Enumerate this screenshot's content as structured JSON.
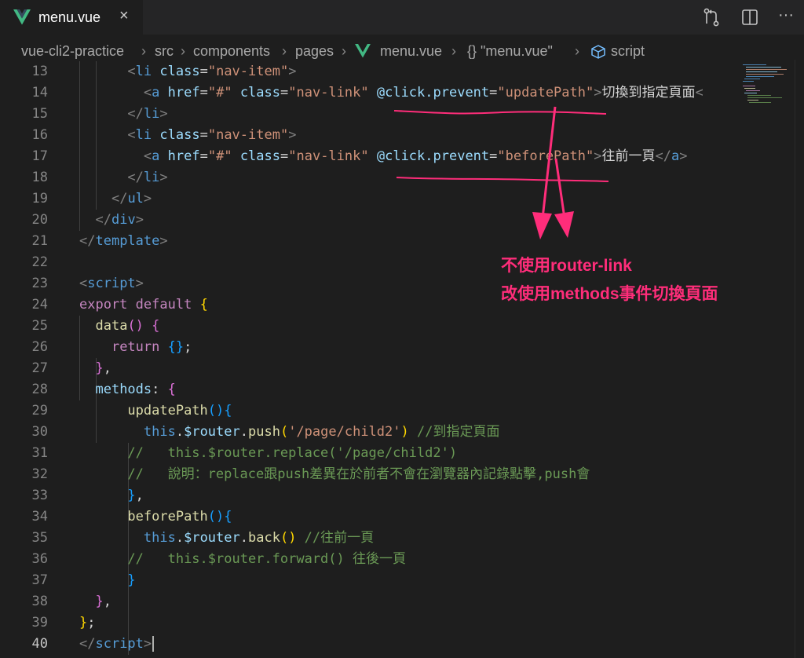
{
  "tab": {
    "title": "menu.vue",
    "close": "×"
  },
  "toolbar": {
    "more": "···"
  },
  "breadcrumbs": [
    "vue-cli2-practice",
    "src",
    "components",
    "pages",
    "menu.vue",
    "{} \"menu.vue\"",
    "script"
  ],
  "annotation": {
    "line1": "不使用router-link",
    "line2": "改使用methods事件切換頁面"
  },
  "colors": {
    "accent": "#ff2d7a",
    "vue_green": "#42b883",
    "background": "#1e1e1e"
  },
  "code_lines": [
    {
      "n": "13",
      "tokens": [
        {
          "t": "      ",
          "c": "#d4d4d4"
        },
        {
          "t": "<",
          "c": "#808080"
        },
        {
          "t": "li",
          "c": "#569cd6"
        },
        {
          "t": " ",
          "c": "#d4d4d4"
        },
        {
          "t": "class",
          "c": "#9cdcfe"
        },
        {
          "t": "=",
          "c": "#d4d4d4"
        },
        {
          "t": "\"nav-item\"",
          "c": "#ce9178"
        },
        {
          "t": ">",
          "c": "#808080"
        }
      ]
    },
    {
      "n": "14",
      "tokens": [
        {
          "t": "        ",
          "c": "#d4d4d4"
        },
        {
          "t": "<",
          "c": "#808080"
        },
        {
          "t": "a",
          "c": "#569cd6"
        },
        {
          "t": " ",
          "c": "#d4d4d4"
        },
        {
          "t": "href",
          "c": "#9cdcfe"
        },
        {
          "t": "=",
          "c": "#d4d4d4"
        },
        {
          "t": "\"#\"",
          "c": "#ce9178"
        },
        {
          "t": " ",
          "c": "#d4d4d4"
        },
        {
          "t": "class",
          "c": "#9cdcfe"
        },
        {
          "t": "=",
          "c": "#d4d4d4"
        },
        {
          "t": "\"nav-link\"",
          "c": "#ce9178"
        },
        {
          "t": " ",
          "c": "#d4d4d4"
        },
        {
          "t": "@click.prevent",
          "c": "#9cdcfe"
        },
        {
          "t": "=",
          "c": "#d4d4d4"
        },
        {
          "t": "\"updatePath\"",
          "c": "#ce9178"
        },
        {
          "t": ">",
          "c": "#808080"
        },
        {
          "t": "切換到指定頁面",
          "c": "#d4d4d4"
        },
        {
          "t": "<",
          "c": "#808080"
        }
      ]
    },
    {
      "n": "15",
      "tokens": [
        {
          "t": "      ",
          "c": "#d4d4d4"
        },
        {
          "t": "</",
          "c": "#808080"
        },
        {
          "t": "li",
          "c": "#569cd6"
        },
        {
          "t": ">",
          "c": "#808080"
        }
      ]
    },
    {
      "n": "16",
      "tokens": [
        {
          "t": "      ",
          "c": "#d4d4d4"
        },
        {
          "t": "<",
          "c": "#808080"
        },
        {
          "t": "li",
          "c": "#569cd6"
        },
        {
          "t": " ",
          "c": "#d4d4d4"
        },
        {
          "t": "class",
          "c": "#9cdcfe"
        },
        {
          "t": "=",
          "c": "#d4d4d4"
        },
        {
          "t": "\"nav-item\"",
          "c": "#ce9178"
        },
        {
          "t": ">",
          "c": "#808080"
        }
      ]
    },
    {
      "n": "17",
      "tokens": [
        {
          "t": "        ",
          "c": "#d4d4d4"
        },
        {
          "t": "<",
          "c": "#808080"
        },
        {
          "t": "a",
          "c": "#569cd6"
        },
        {
          "t": " ",
          "c": "#d4d4d4"
        },
        {
          "t": "href",
          "c": "#9cdcfe"
        },
        {
          "t": "=",
          "c": "#d4d4d4"
        },
        {
          "t": "\"#\"",
          "c": "#ce9178"
        },
        {
          "t": " ",
          "c": "#d4d4d4"
        },
        {
          "t": "class",
          "c": "#9cdcfe"
        },
        {
          "t": "=",
          "c": "#d4d4d4"
        },
        {
          "t": "\"nav-link\"",
          "c": "#ce9178"
        },
        {
          "t": " ",
          "c": "#d4d4d4"
        },
        {
          "t": "@click.prevent",
          "c": "#9cdcfe"
        },
        {
          "t": "=",
          "c": "#d4d4d4"
        },
        {
          "t": "\"beforePath\"",
          "c": "#ce9178"
        },
        {
          "t": ">",
          "c": "#808080"
        },
        {
          "t": "往前一頁",
          "c": "#d4d4d4"
        },
        {
          "t": "</",
          "c": "#808080"
        },
        {
          "t": "a",
          "c": "#569cd6"
        },
        {
          "t": ">",
          "c": "#808080"
        }
      ]
    },
    {
      "n": "18",
      "tokens": [
        {
          "t": "      ",
          "c": "#d4d4d4"
        },
        {
          "t": "</",
          "c": "#808080"
        },
        {
          "t": "li",
          "c": "#569cd6"
        },
        {
          "t": ">",
          "c": "#808080"
        }
      ]
    },
    {
      "n": "19",
      "tokens": [
        {
          "t": "    ",
          "c": "#d4d4d4"
        },
        {
          "t": "</",
          "c": "#808080"
        },
        {
          "t": "ul",
          "c": "#569cd6"
        },
        {
          "t": ">",
          "c": "#808080"
        }
      ]
    },
    {
      "n": "20",
      "tokens": [
        {
          "t": "  ",
          "c": "#d4d4d4"
        },
        {
          "t": "</",
          "c": "#808080"
        },
        {
          "t": "div",
          "c": "#569cd6"
        },
        {
          "t": ">",
          "c": "#808080"
        }
      ]
    },
    {
      "n": "21",
      "tokens": [
        {
          "t": "</",
          "c": "#808080"
        },
        {
          "t": "template",
          "c": "#569cd6"
        },
        {
          "t": ">",
          "c": "#808080"
        }
      ]
    },
    {
      "n": "22",
      "tokens": []
    },
    {
      "n": "23",
      "tokens": [
        {
          "t": "<",
          "c": "#808080"
        },
        {
          "t": "script",
          "c": "#569cd6"
        },
        {
          "t": ">",
          "c": "#808080"
        }
      ]
    },
    {
      "n": "24",
      "tokens": [
        {
          "t": "export",
          "c": "#c586c0"
        },
        {
          "t": " ",
          "c": "#d4d4d4"
        },
        {
          "t": "default",
          "c": "#c586c0"
        },
        {
          "t": " ",
          "c": "#d4d4d4"
        },
        {
          "t": "{",
          "c": "#ffd700"
        }
      ]
    },
    {
      "n": "25",
      "tokens": [
        {
          "t": "  ",
          "c": "#d4d4d4"
        },
        {
          "t": "data",
          "c": "#dcdcaa"
        },
        {
          "t": "()",
          "c": "#da70d6"
        },
        {
          "t": " ",
          "c": "#d4d4d4"
        },
        {
          "t": "{",
          "c": "#da70d6"
        }
      ]
    },
    {
      "n": "26",
      "tokens": [
        {
          "t": "    ",
          "c": "#d4d4d4"
        },
        {
          "t": "return",
          "c": "#c586c0"
        },
        {
          "t": " ",
          "c": "#d4d4d4"
        },
        {
          "t": "{}",
          "c": "#179fff"
        },
        {
          "t": ";",
          "c": "#d4d4d4"
        }
      ]
    },
    {
      "n": "27",
      "tokens": [
        {
          "t": "  ",
          "c": "#d4d4d4"
        },
        {
          "t": "}",
          "c": "#da70d6"
        },
        {
          "t": ",",
          "c": "#d4d4d4"
        }
      ]
    },
    {
      "n": "28",
      "tokens": [
        {
          "t": "  ",
          "c": "#d4d4d4"
        },
        {
          "t": "methods",
          "c": "#9cdcfe"
        },
        {
          "t": ": ",
          "c": "#d4d4d4"
        },
        {
          "t": "{",
          "c": "#da70d6"
        }
      ]
    },
    {
      "n": "29",
      "tokens": [
        {
          "t": "      ",
          "c": "#d4d4d4"
        },
        {
          "t": "updatePath",
          "c": "#dcdcaa"
        },
        {
          "t": "(){",
          "c": "#179fff"
        }
      ]
    },
    {
      "n": "30",
      "tokens": [
        {
          "t": "        ",
          "c": "#d4d4d4"
        },
        {
          "t": "this",
          "c": "#569cd6"
        },
        {
          "t": ".",
          "c": "#d4d4d4"
        },
        {
          "t": "$router",
          "c": "#9cdcfe"
        },
        {
          "t": ".",
          "c": "#d4d4d4"
        },
        {
          "t": "push",
          "c": "#dcdcaa"
        },
        {
          "t": "(",
          "c": "#ffd700"
        },
        {
          "t": "'/page/child2'",
          "c": "#ce9178"
        },
        {
          "t": ")",
          "c": "#ffd700"
        },
        {
          "t": " //到指定頁面",
          "c": "#6a9955"
        }
      ]
    },
    {
      "n": "31",
      "tokens": [
        {
          "t": "      ",
          "c": "#d4d4d4"
        },
        {
          "t": "//   this.$router.replace('/page/child2')",
          "c": "#6a9955"
        }
      ]
    },
    {
      "n": "32",
      "tokens": [
        {
          "t": "      ",
          "c": "#d4d4d4"
        },
        {
          "t": "//   說明：replace跟push差異在於前者不會在瀏覽器內記錄點擊,push會",
          "c": "#6a9955"
        }
      ]
    },
    {
      "n": "33",
      "tokens": [
        {
          "t": "      ",
          "c": "#d4d4d4"
        },
        {
          "t": "}",
          "c": "#179fff"
        },
        {
          "t": ",",
          "c": "#d4d4d4"
        }
      ]
    },
    {
      "n": "34",
      "tokens": [
        {
          "t": "      ",
          "c": "#d4d4d4"
        },
        {
          "t": "beforePath",
          "c": "#dcdcaa"
        },
        {
          "t": "(){",
          "c": "#179fff"
        }
      ]
    },
    {
      "n": "35",
      "tokens": [
        {
          "t": "        ",
          "c": "#d4d4d4"
        },
        {
          "t": "this",
          "c": "#569cd6"
        },
        {
          "t": ".",
          "c": "#d4d4d4"
        },
        {
          "t": "$router",
          "c": "#9cdcfe"
        },
        {
          "t": ".",
          "c": "#d4d4d4"
        },
        {
          "t": "back",
          "c": "#dcdcaa"
        },
        {
          "t": "()",
          "c": "#ffd700"
        },
        {
          "t": " //往前一頁",
          "c": "#6a9955"
        }
      ]
    },
    {
      "n": "36",
      "tokens": [
        {
          "t": "      ",
          "c": "#d4d4d4"
        },
        {
          "t": "//   this.$router.forward() 往後一頁",
          "c": "#6a9955"
        }
      ]
    },
    {
      "n": "37",
      "tokens": [
        {
          "t": "      ",
          "c": "#d4d4d4"
        },
        {
          "t": "}",
          "c": "#179fff"
        }
      ]
    },
    {
      "n": "38",
      "tokens": [
        {
          "t": "  ",
          "c": "#d4d4d4"
        },
        {
          "t": "}",
          "c": "#da70d6"
        },
        {
          "t": ",",
          "c": "#d4d4d4"
        }
      ]
    },
    {
      "n": "39",
      "tokens": [
        {
          "t": "}",
          "c": "#ffd700"
        },
        {
          "t": ";",
          "c": "#d4d4d4"
        }
      ]
    },
    {
      "n": "40",
      "tokens": [
        {
          "t": "</",
          "c": "#808080"
        },
        {
          "t": "script",
          "c": "#569cd6"
        },
        {
          "t": ">",
          "c": "#808080"
        }
      ],
      "current": true
    }
  ]
}
